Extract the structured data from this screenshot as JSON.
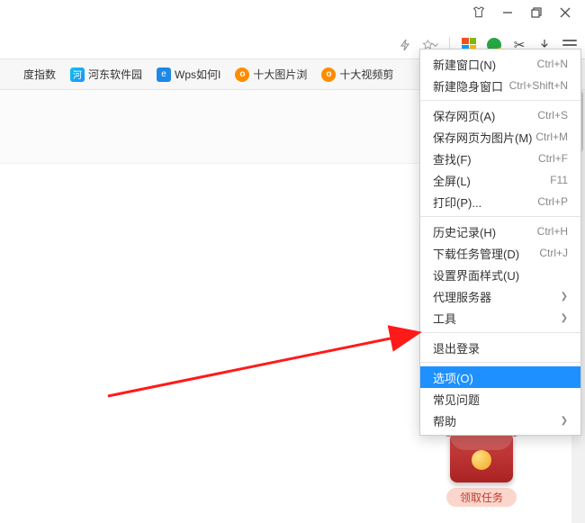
{
  "windowControls": {
    "shirt": "shirt-icon",
    "min": "minimize",
    "max": "restore",
    "close": "close"
  },
  "toolbar": {
    "lightning": "lightning-icon",
    "star": "favorites-star",
    "scissors": "✂",
    "download": "download",
    "menu": "hamburger"
  },
  "bookmarks": [
    {
      "label": "度指数"
    },
    {
      "label": "河东软件园"
    },
    {
      "label": "Wps如何I"
    },
    {
      "label": "十大图片浏"
    },
    {
      "label": "十大视频剪"
    }
  ],
  "promo": {
    "badge": "红包",
    "pill": "领取任务"
  },
  "menu": {
    "groups": [
      [
        {
          "label": "新建窗口(N)",
          "short": "Ctrl+N"
        },
        {
          "label": "新建隐身窗口",
          "short": "Ctrl+Shift+N"
        }
      ],
      [
        {
          "label": "保存网页(A)",
          "short": "Ctrl+S"
        },
        {
          "label": "保存网页为图片(M)",
          "short": "Ctrl+M"
        },
        {
          "label": "查找(F)",
          "short": "Ctrl+F"
        },
        {
          "label": "全屏(L)",
          "short": "F11"
        },
        {
          "label": "打印(P)...",
          "short": "Ctrl+P"
        }
      ],
      [
        {
          "label": "历史记录(H)",
          "short": "Ctrl+H"
        },
        {
          "label": "下载任务管理(D)",
          "short": "Ctrl+J"
        },
        {
          "label": "设置界面样式(U)"
        },
        {
          "label": "代理服务器",
          "sub": true
        },
        {
          "label": "工具",
          "sub": true
        }
      ],
      [
        {
          "label": "退出登录"
        }
      ],
      [
        {
          "label": "选项(O)",
          "selected": true
        },
        {
          "label": "常见问题"
        },
        {
          "label": "帮助",
          "sub": true
        }
      ]
    ]
  }
}
